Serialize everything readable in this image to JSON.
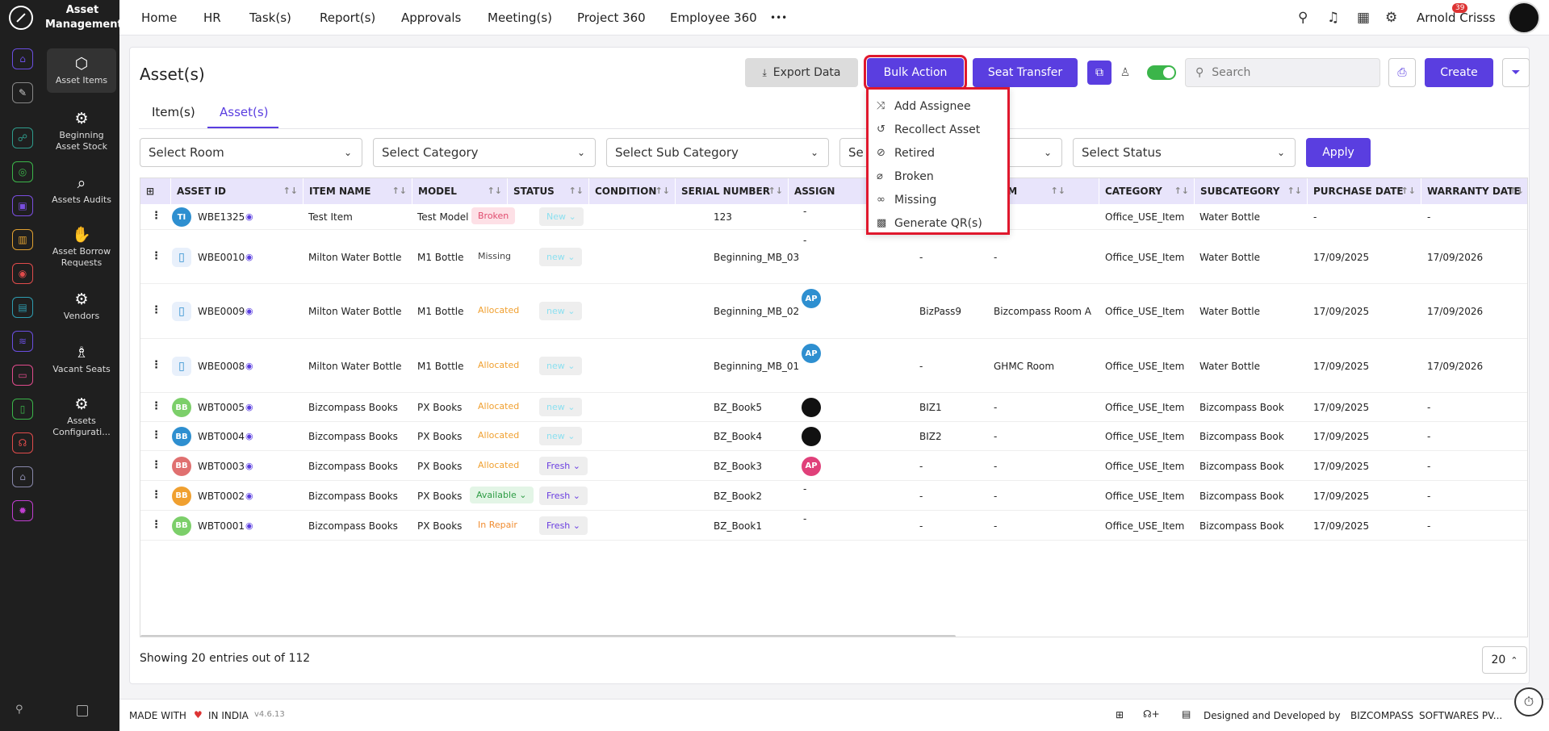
{
  "app": {
    "module_title": "Asset Management"
  },
  "sidebar": {
    "items": [
      {
        "label": "Asset Items",
        "icon": "cube-icon"
      },
      {
        "label": "Beginning Asset Stock",
        "icon": "gear-icon"
      },
      {
        "label": "Assets Audits",
        "icon": "audit-icon"
      },
      {
        "label": "Asset Borrow Requests",
        "icon": "hand-icon"
      },
      {
        "label": "Vendors",
        "icon": "gear-icon"
      },
      {
        "label": "Vacant Seats",
        "icon": "seat-icon"
      },
      {
        "label": "Assets Configurati...",
        "icon": "gear-icon"
      }
    ]
  },
  "topnav": {
    "items": [
      "Home",
      "HR",
      "Task(s)",
      "Report(s)",
      "Approvals",
      "Meeting(s)",
      "Project 360",
      "Employee 360"
    ],
    "more": "•••",
    "notification_count": "39",
    "user_name": "Arnold Crisss"
  },
  "page": {
    "title": "Asset(s)"
  },
  "toolbar": {
    "export_label": "Export Data",
    "bulk_action_label": "Bulk Action",
    "seat_transfer_label": "Seat Transfer",
    "search_placeholder": "Search",
    "create_label": "Create"
  },
  "tabs": [
    "Item(s)",
    "Asset(s)"
  ],
  "active_tab": "Asset(s)",
  "filters": {
    "room": "Select Room",
    "category": "Select Category",
    "sub_category": "Select Sub Category",
    "hidden_filter": "Se",
    "status": "Select Status",
    "apply_label": "Apply"
  },
  "bulk_menu": {
    "items": [
      "Add Assignee",
      "Recollect Asset",
      "Retired",
      "Broken",
      "Missing",
      "Generate QR(s)"
    ]
  },
  "table": {
    "columns": [
      "ASSET ID",
      "ITEM NAME",
      "MODEL",
      "STATUS",
      "CONDITION",
      "SERIAL NUMBER",
      "ASSIGN",
      "OM",
      "CATEGORY",
      "SUBCATEGORY",
      "PURCHASE DATE",
      "WARRANTY DATE"
    ],
    "rows": [
      {
        "avatar": "TI",
        "asset_id": "WBE1325",
        "item": "Test Item",
        "model": "Test Model",
        "status": "Broken",
        "condition": "New",
        "serial": "123",
        "assignee": "-",
        "seat": "",
        "room": "",
        "category": "Office_USE_Item",
        "subcategory": "Water Bottle",
        "purchase": "-",
        "warranty": "-"
      },
      {
        "avatar": "",
        "asset_id": "WBE0010",
        "item": "Milton Water Bottle",
        "model": "M1 Bottle",
        "status": "Missing",
        "condition": "new",
        "serial": "Beginning_MB_03",
        "assignee": "-",
        "seat": "-",
        "room": "-",
        "category": "Office_USE_Item",
        "subcategory": "Water Bottle",
        "purchase": "17/09/2025",
        "warranty": "17/09/2026"
      },
      {
        "avatar": "",
        "asset_id": "WBE0009",
        "item": "Milton Water Bottle",
        "model": "M1 Bottle",
        "status": "Allocated",
        "condition": "new",
        "serial": "Beginning_MB_02",
        "assignee": "AP",
        "seat": "BizPass9",
        "room": "Bizcompass Room A",
        "category": "Office_USE_Item",
        "subcategory": "Water Bottle",
        "purchase": "17/09/2025",
        "warranty": "17/09/2026"
      },
      {
        "avatar": "",
        "asset_id": "WBE0008",
        "item": "Milton Water Bottle",
        "model": "M1 Bottle",
        "status": "Allocated",
        "condition": "new",
        "serial": "Beginning_MB_01",
        "assignee": "AP",
        "seat": "-",
        "room": "GHMC Room",
        "category": "Office_USE_Item",
        "subcategory": "Water Bottle",
        "purchase": "17/09/2025",
        "warranty": "17/09/2026"
      },
      {
        "avatar": "BB",
        "asset_id": "WBT0005",
        "item": "Bizcompass Books",
        "model": "PX Books",
        "status": "Allocated",
        "condition": "new",
        "serial": "BZ_Book5",
        "assignee": "",
        "seat": "BIZ1",
        "room": "-",
        "category": "Office_USE_Item",
        "subcategory": "Bizcompass Book",
        "purchase": "17/09/2025",
        "warranty": "-"
      },
      {
        "avatar": "BB",
        "asset_id": "WBT0004",
        "item": "Bizcompass Books",
        "model": "PX Books",
        "status": "Allocated",
        "condition": "new",
        "serial": "BZ_Book4",
        "assignee": "",
        "seat": "BIZ2",
        "room": "-",
        "category": "Office_USE_Item",
        "subcategory": "Bizcompass Book",
        "purchase": "17/09/2025",
        "warranty": "-"
      },
      {
        "avatar": "BB",
        "asset_id": "WBT0003",
        "item": "Bizcompass Books",
        "model": "PX Books",
        "status": "Allocated",
        "condition": "Fresh",
        "serial": "BZ_Book3",
        "assignee": "AP",
        "seat": "-",
        "room": "-",
        "category": "Office_USE_Item",
        "subcategory": "Bizcompass Book",
        "purchase": "17/09/2025",
        "warranty": "-"
      },
      {
        "avatar": "BB",
        "asset_id": "WBT0002",
        "item": "Bizcompass Books",
        "model": "PX Books",
        "status": "Available",
        "condition": "Fresh",
        "serial": "BZ_Book2",
        "assignee": "-",
        "seat": "-",
        "room": "-",
        "category": "Office_USE_Item",
        "subcategory": "Bizcompass Book",
        "purchase": "17/09/2025",
        "warranty": "-"
      },
      {
        "avatar": "BB",
        "asset_id": "WBT0001",
        "item": "Bizcompass Books",
        "model": "PX Books",
        "status": "In Repair",
        "condition": "Fresh",
        "serial": "BZ_Book1",
        "assignee": "-",
        "seat": "-",
        "room": "-",
        "category": "Office_USE_Item",
        "subcategory": "Bizcompass Book",
        "purchase": "17/09/2025",
        "warranty": "-"
      }
    ]
  },
  "pagination": {
    "summary": "Showing 20 entries out of 112",
    "page_size": "20"
  },
  "footer": {
    "made_with": "MADE WITH",
    "in_india": "IN INDIA",
    "version": "v4.6.13",
    "designed_by": "Designed and Developed by",
    "company": "BIZCOMPASS",
    "company_suffix": "SOFTWARES PV..."
  },
  "colors": {
    "accent": "#5a3ee0",
    "highlight": "#e0182d",
    "sidebar_bg": "#1f1f1f"
  }
}
